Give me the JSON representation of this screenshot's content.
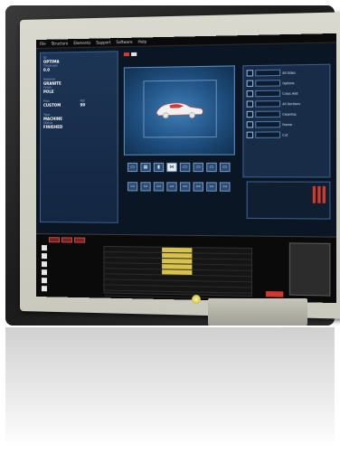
{
  "menu": [
    "File",
    "Structure",
    "Elements",
    "Support",
    "Software",
    "Help"
  ],
  "left_panel": {
    "block1": [
      {
        "label": "ID",
        "value": "OPTIMA"
      },
      {
        "label": "Thickness",
        "value": "0.0"
      }
    ],
    "block2": [
      {
        "label": "Material",
        "value": "GRANITE"
      },
      {
        "label": "Finish",
        "value": "POLE"
      }
    ],
    "block3": [
      {
        "label": "Plan",
        "value": "CUSTOM"
      },
      {
        "label": "Ref",
        "value": "99"
      }
    ],
    "block4": [
      {
        "label": "Type",
        "value": "MACHINE"
      },
      {
        "label": "Status",
        "value": "FINISHED"
      }
    ]
  },
  "top_strip": {
    "label1": "",
    "label2": ""
  },
  "right_panel": {
    "rows": [
      {
        "button": "",
        "text": "All Sides"
      },
      {
        "button": "",
        "text": "Options"
      },
      {
        "button": "",
        "text": "Cross Add"
      },
      {
        "button": "",
        "text": "All Sections"
      },
      {
        "button": "",
        "text": "Cleaning"
      },
      {
        "button": "",
        "text": "Frame"
      },
      {
        "button": "",
        "text": "Cut"
      }
    ]
  },
  "toolbar": {
    "tools": [
      "▭",
      "▦",
      "▮",
      "⋈",
      "▭",
      "▭",
      "▭",
      "▭",
      "▭",
      "▭",
      "▭",
      "▭",
      "▭",
      "▭",
      "▭",
      "▭"
    ]
  },
  "readout": {
    "lines": [
      "",
      "",
      ""
    ]
  },
  "table": {
    "rows": [
      [
        "",
        "",
        "",
        "",
        ""
      ],
      [
        "",
        "",
        "",
        "",
        ""
      ],
      [
        "",
        "",
        "",
        "",
        ""
      ],
      [
        "",
        "",
        "",
        "",
        ""
      ],
      [
        "",
        "",
        "",
        "",
        ""
      ],
      [
        "",
        "",
        "",
        "",
        ""
      ],
      [
        "",
        "",
        "",
        "",
        ""
      ],
      [
        "",
        "",
        "",
        "",
        ""
      ],
      [
        "",
        "",
        "",
        "",
        ""
      ]
    ]
  },
  "colors": {
    "accent": "#3d5f8c",
    "warning": "#d23b2a",
    "highlight": "#d9c24a"
  }
}
